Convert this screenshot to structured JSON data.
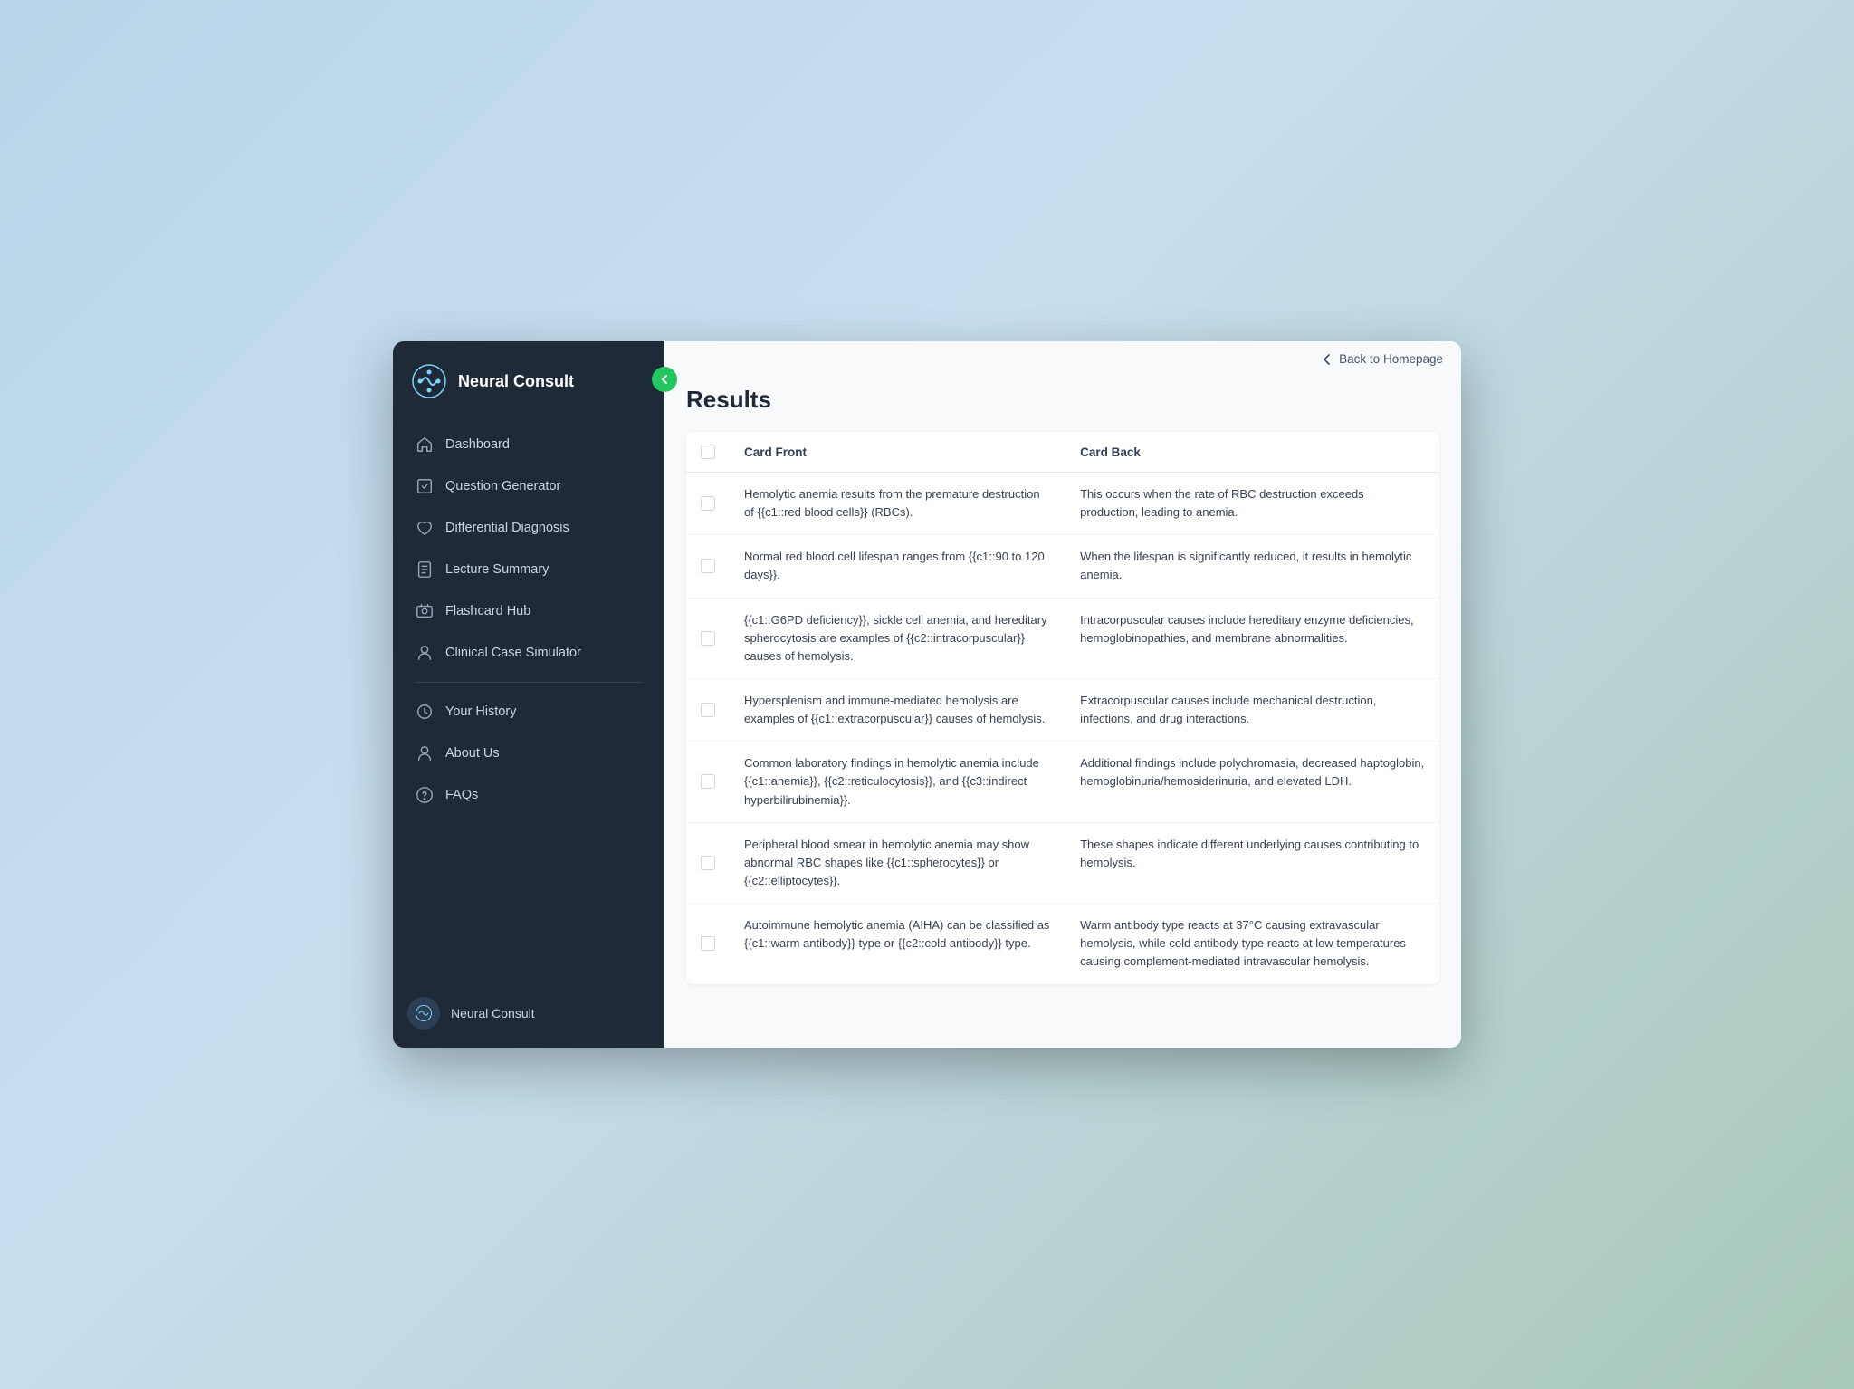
{
  "app": {
    "title": "Neural Consult",
    "back_label": "Back to Homepage"
  },
  "sidebar": {
    "nav_items": [
      {
        "id": "dashboard",
        "label": "Dashboard"
      },
      {
        "id": "question-generator",
        "label": "Question Generator"
      },
      {
        "id": "differential-diagnosis",
        "label": "Differential Diagnosis"
      },
      {
        "id": "lecture-summary",
        "label": "Lecture Summary"
      },
      {
        "id": "flashcard-hub",
        "label": "Flashcard Hub"
      },
      {
        "id": "clinical-case-simulator",
        "label": "Clinical Case Simulator"
      }
    ],
    "bottom_items": [
      {
        "id": "your-history",
        "label": "Your History"
      },
      {
        "id": "about-us",
        "label": "About Us"
      },
      {
        "id": "faqs",
        "label": "FAQs"
      }
    ],
    "footer_label": "Neural Consult"
  },
  "main": {
    "results_title": "Results",
    "table": {
      "col_front": "Card Front",
      "col_back": "Card Back",
      "rows": [
        {
          "front": "Hemolytic anemia results from the premature destruction of {{c1::red blood cells}} (RBCs).",
          "back": "This occurs when the rate of RBC destruction exceeds production, leading to anemia."
        },
        {
          "front": "Normal red blood cell lifespan ranges from {{c1::90 to 120 days}}.",
          "back": "When the lifespan is significantly reduced, it results in hemolytic anemia."
        },
        {
          "front": "{{c1::G6PD deficiency}}, sickle cell anemia, and hereditary spherocytosis are examples of {{c2::intracorpuscular}} causes of hemolysis.",
          "back": "Intracorpuscular causes include hereditary enzyme deficiencies, hemoglobinopathies, and membrane abnormalities."
        },
        {
          "front": "Hypersplenism and immune-mediated hemolysis are examples of {{c1::extracorpuscular}} causes of hemolysis.",
          "back": "Extracorpuscular causes include mechanical destruction, infections, and drug interactions."
        },
        {
          "front": "Common laboratory findings in hemolytic anemia include {{c1::anemia}}, {{c2::reticulocytosis}}, and {{c3::indirect hyperbilirubinemia}}.",
          "back": "Additional findings include polychromasia, decreased haptoglobin, hemoglobinuria/hemosiderinuria, and elevated LDH."
        },
        {
          "front": "Peripheral blood smear in hemolytic anemia may show abnormal RBC shapes like {{c1::spherocytes}} or {{c2::elliptocytes}}.",
          "back": "These shapes indicate different underlying causes contributing to hemolysis."
        },
        {
          "front": "Autoimmune hemolytic anemia (AIHA) can be classified as {{c1::warm antibody}} type or {{c2::cold antibody}} type.",
          "back": "Warm antibody type reacts at 37°C causing extravascular hemolysis, while cold antibody type reacts at low temperatures causing complement-mediated intravascular hemolysis."
        }
      ]
    }
  }
}
